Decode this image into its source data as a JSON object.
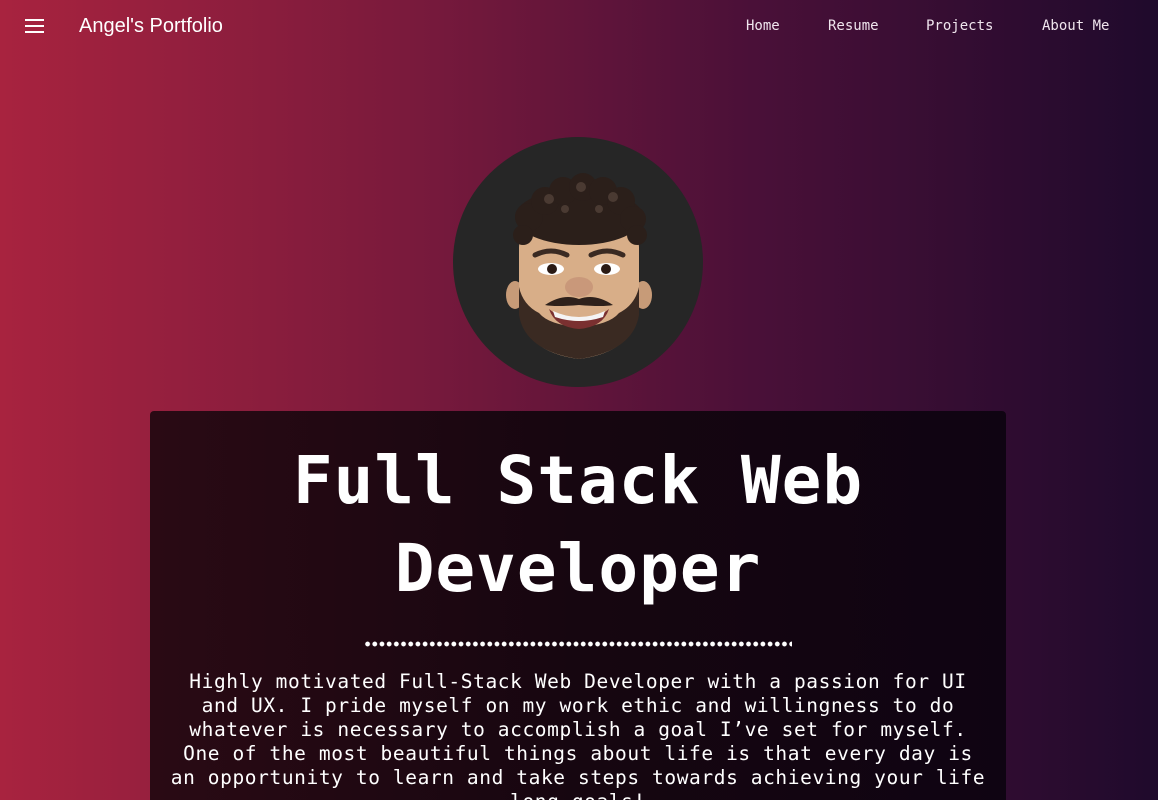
{
  "navbar": {
    "menu_icon": "hamburger-menu-icon",
    "brand": "Angel's Portfolio",
    "links": [
      "Home",
      "Resume",
      "Projects",
      "About Me"
    ]
  },
  "hero": {
    "avatar_alt": "memoji-avatar",
    "headline": "Full Stack Web Developer",
    "bio": "Highly motivated Full-Stack Web Developer with a passion for UI and UX. I pride myself on my work ethic and willingness to do whatever is necessary to accomplish a goal I’ve set for myself. One of the most beautiful things about life is that every day is an opportunity to learn and take steps towards achieving your life long goals!"
  },
  "colors": {
    "gradient_start": "#a8233f",
    "gradient_end": "#1f0a2c",
    "card_bg": "#160610",
    "avatar_bg": "#262626"
  }
}
